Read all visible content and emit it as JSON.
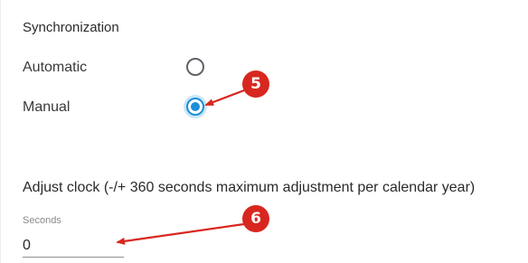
{
  "synchronization": {
    "title": "Synchronization",
    "options": [
      {
        "label": "Automatic",
        "checked": false
      },
      {
        "label": "Manual",
        "checked": true
      }
    ]
  },
  "adjust_clock": {
    "title": "Adjust clock (-/+ 360 seconds maximum adjustment per calendar year)",
    "field_label": "Seconds",
    "field_value": "0"
  },
  "callouts": {
    "five": "5",
    "six": "6"
  },
  "colors": {
    "accent": "#1a8fd8",
    "callout": "#d8271f"
  },
  "icons": {
    "callout_arrow": "arrow-icon"
  }
}
